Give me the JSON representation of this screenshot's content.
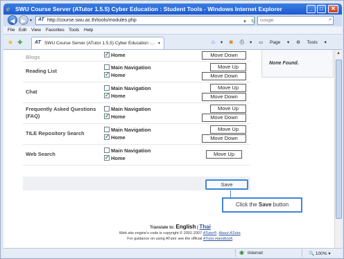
{
  "window": {
    "title": "SWU Course Server (ATutor 1.5.5) Cyber Education : Student Tools - Windows Internet Explorer",
    "minimize": "_",
    "maximize": "□",
    "close": "✕"
  },
  "address_bar": {
    "url": "http://course.swu.ac.th/tools/modules.php",
    "search_placeholder": "Google"
  },
  "menu": [
    "File",
    "Edit",
    "View",
    "Favorites",
    "Tools",
    "Help"
  ],
  "tab": {
    "label": "SWU Course Server (ATutor 1.5.5) Cyber Education :..."
  },
  "command_bar": {
    "page": "Page",
    "tools": "Tools"
  },
  "modules": [
    {
      "name": "Blogs",
      "checks": [
        {
          "label": "Home",
          "checked": true
        }
      ],
      "buttons": [
        "Move Down"
      ]
    },
    {
      "name": "Reading List",
      "checks": [
        {
          "label": "Main Navigation",
          "checked": false
        },
        {
          "label": "Home",
          "checked": true
        }
      ],
      "buttons": [
        "Move Up",
        "Move Down"
      ]
    },
    {
      "name": "Chat",
      "checks": [
        {
          "label": "Main Navigation",
          "checked": false
        },
        {
          "label": "Home",
          "checked": true
        }
      ],
      "buttons": [
        "Move Up",
        "Move Down"
      ]
    },
    {
      "name": "Frequently Asked Questions (FAQ)",
      "checks": [
        {
          "label": "Main Navigation",
          "checked": false
        },
        {
          "label": "Home",
          "checked": true
        }
      ],
      "buttons": [
        "Move Up",
        "Move Down"
      ]
    },
    {
      "name": "TILE Repository Search",
      "checks": [
        {
          "label": "Main Navigation",
          "checked": false
        },
        {
          "label": "Home",
          "checked": true
        }
      ],
      "buttons": [
        "Move Up",
        "Move Down"
      ]
    },
    {
      "name": "Web Search",
      "checks": [
        {
          "label": "Main Navigation",
          "checked": false
        },
        {
          "label": "Home",
          "checked": true
        }
      ],
      "buttons": [
        "Move Up"
      ]
    }
  ],
  "save_label": "Save",
  "callout": {
    "prefix": "Click the ",
    "bold": "Save",
    "suffix": " button"
  },
  "side_panel": {
    "text": "None Found."
  },
  "footer": {
    "translate_prefix": "Translate to: ",
    "lang_current": "English",
    "lang_sep": " | ",
    "lang_other": "Thai",
    "line2_text": "Web site engine's code is copyright © 2001-2007 ",
    "line2_link1": "ATutor®",
    "line2_sep": ". ",
    "line2_link2": "About ATutor",
    "line2_end": ".",
    "line3_text": "For guidance on using ATutor see the official ",
    "line3_link": "ATutor Handbook",
    "line3_end": "."
  },
  "status_bar": {
    "zone": "Internet",
    "zoom": "100%"
  },
  "colors": {
    "accent": "#3c86d6",
    "titlebar": "#1c5bd0"
  }
}
